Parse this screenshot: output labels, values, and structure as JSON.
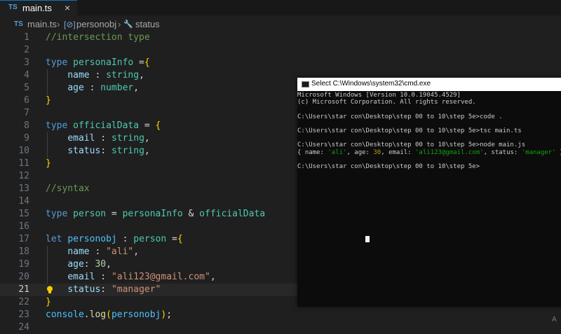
{
  "tab": {
    "lang_badge": "TS",
    "filename": "main.ts",
    "close": "×"
  },
  "breadcrumb": {
    "lang_badge": "TS",
    "file": "main.ts",
    "sep": "›",
    "obj_icon": "[⊘]",
    "obj": "personobj",
    "prop_icon": "🔧",
    "prop": "status"
  },
  "editor": {
    "line_numbers": [
      "1",
      "2",
      "3",
      "4",
      "5",
      "6",
      "7",
      "8",
      "9",
      "10",
      "11",
      "12",
      "13",
      "14",
      "15",
      "16",
      "17",
      "18",
      "19",
      "20",
      "21",
      "22",
      "23",
      "24"
    ],
    "current_line": "21",
    "lines": {
      "l1_comment": "//intersection type",
      "l3_kw": "type",
      "l3_name": "personaInfo",
      "l3_eq": " =",
      "l3_brace": "{",
      "l4_prop": "name",
      "l4_colon": " : ",
      "l4_type": "string",
      "l4_end": ",",
      "l5_prop": "age",
      "l5_colon": " : ",
      "l5_type": "number",
      "l5_end": ",",
      "l6_brace": "}",
      "l8_kw": "type",
      "l8_name": "officialData",
      "l8_eq": " = ",
      "l8_brace": "{",
      "l9_prop": "email",
      "l9_colon": " : ",
      "l9_type": "string",
      "l9_end": ",",
      "l10_prop": "status",
      "l10_colon": ": ",
      "l10_type": "string",
      "l10_end": ",",
      "l11_brace": "}",
      "l13_comment": "//syntax",
      "l15_kw": "type",
      "l15_name": "person",
      "l15_eq": " = ",
      "l15_t1": "personaInfo",
      "l15_amp": " & ",
      "l15_t2": "officialData",
      "l17_kw": "let",
      "l17_var": "personobj",
      "l17_colon": " : ",
      "l17_type": "person",
      "l17_eq": " =",
      "l17_brace": "{",
      "l18_prop": "name",
      "l18_colon": " : ",
      "l18_val": "\"ali\"",
      "l18_end": ",",
      "l19_prop": "age",
      "l19_colon": ": ",
      "l19_val": "30",
      "l19_end": ",",
      "l20_prop": "email",
      "l20_colon": " : ",
      "l20_val": "\"ali123@gmail.com\"",
      "l20_end": ",",
      "l21_prop": "status",
      "l21_colon": ": ",
      "l21_val": "\"manager\"",
      "l22_brace": "}",
      "l23_obj": "console",
      "l23_dot": ".",
      "l23_fn": "log",
      "l23_open": "(",
      "l23_arg": "personobj",
      "l23_close": ")",
      "l23_end": ";"
    }
  },
  "cmd": {
    "title": "Select C:\\Windows\\system32\\cmd.exe",
    "lines": [
      "Microsoft Windows [Version 10.0.19045.4529]",
      "(c) Microsoft Corporation. All rights reserved.",
      "",
      "C:\\Users\\star con\\Desktop\\step 00 to 10\\step 5e>code .",
      "",
      "C:\\Users\\star con\\Desktop\\step 00 to 10\\step 5e>tsc main.ts",
      "",
      "C:\\Users\\star con\\Desktop\\step 00 to 10\\step 5e>node main.js"
    ],
    "output": {
      "p1": "{ name: ",
      "v1": "'ali'",
      "p2": ", age: ",
      "v2": "30",
      "p3": ", email: ",
      "v3": "'ali123@gmail.com'",
      "p4": ", status: ",
      "v4": "'manager'",
      "p5": " }"
    },
    "prompt": "C:\\Users\\star con\\Desktop\\step 00 to 10\\step 5e>"
  },
  "corner_text": "A",
  "colors": {
    "keyword": "#569cd6",
    "type": "#4ec9b0",
    "property": "#9cdcfe",
    "comment": "#6a9955",
    "string": "#ce9178",
    "number": "#b5cea8",
    "bracket": "#ffd700",
    "terminal_green": "#13a10e"
  }
}
